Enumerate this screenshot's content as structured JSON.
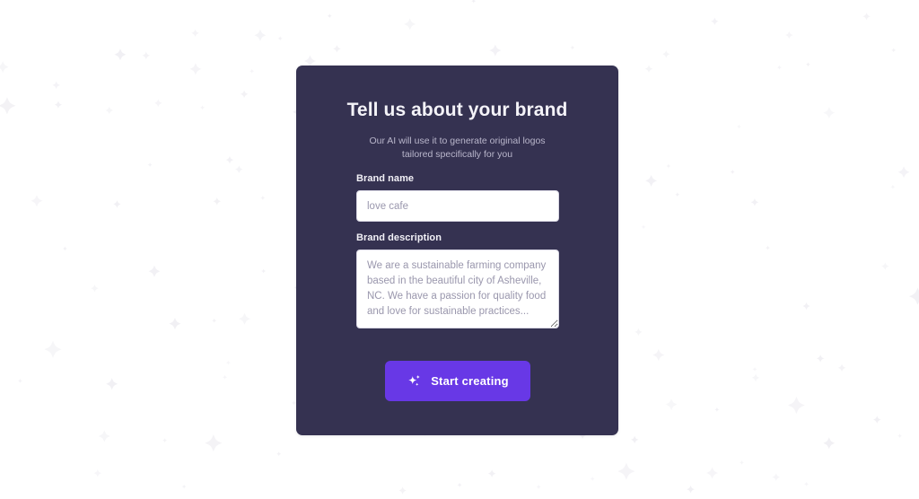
{
  "page": {
    "background_color": "#ffffff",
    "sparkle_color": "#f1f0f4"
  },
  "card": {
    "background_color": "#353251",
    "heading": "Tell us about your brand",
    "subtitle": "Our AI will use it to generate original logos tailored specifically for you"
  },
  "form": {
    "brand_name": {
      "label": "Brand name",
      "placeholder": "love cafe",
      "value": ""
    },
    "brand_description": {
      "label": "Brand description",
      "placeholder": "We are a sustainable farming company based in the beautiful city of Asheville, NC. We have a passion for quality food and love for sustainable practices...",
      "value": ""
    }
  },
  "cta": {
    "label": "Start creating",
    "icon": "sparkles-icon",
    "background_color": "#6838e6",
    "text_color": "#ffffff"
  }
}
